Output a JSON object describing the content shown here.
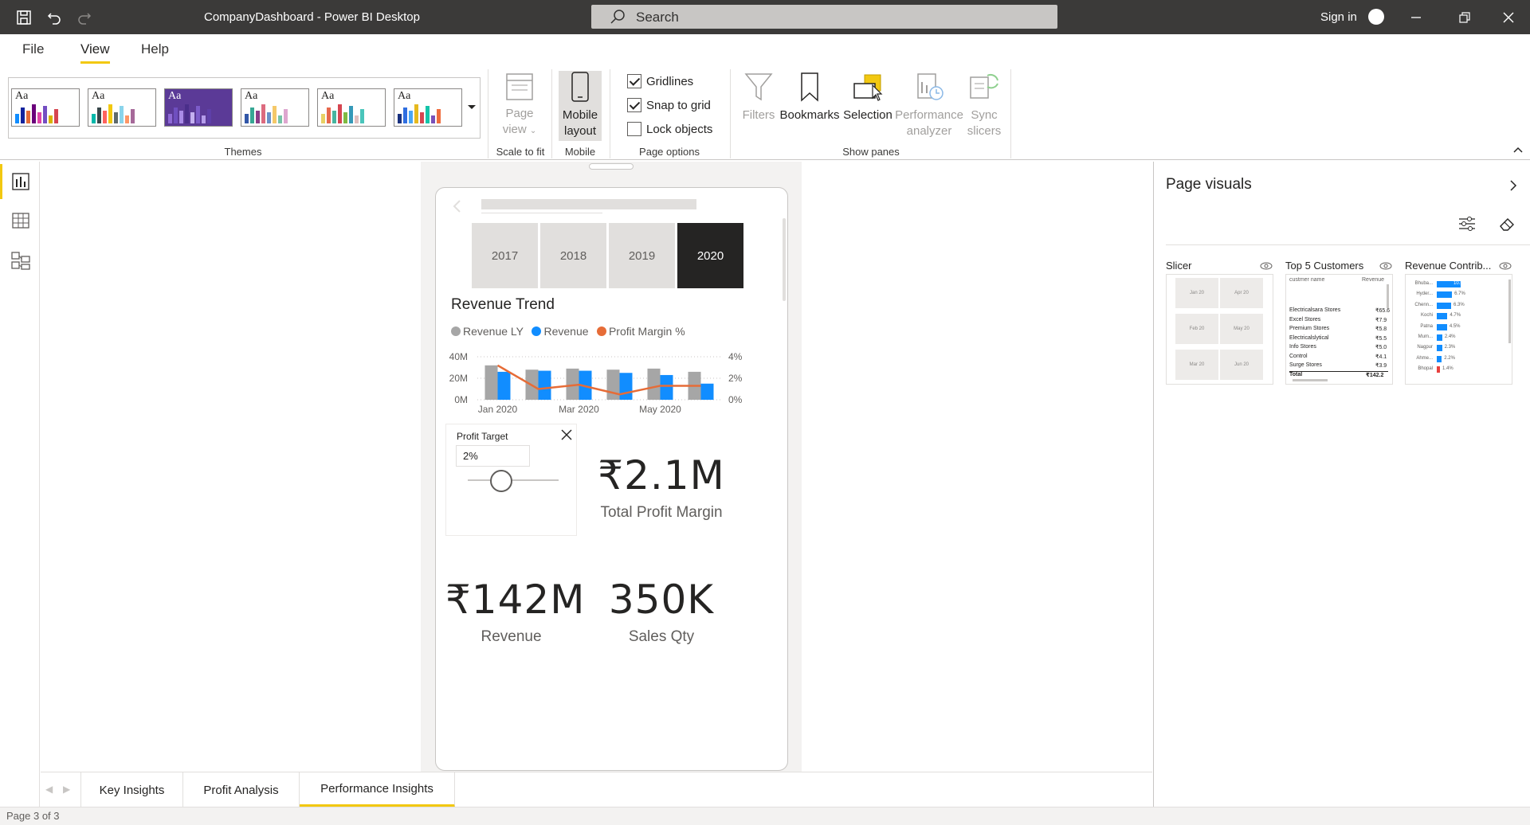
{
  "window": {
    "title": "CompanyDashboard - Power BI Desktop",
    "search_placeholder": "Search",
    "sign_in": "Sign in"
  },
  "menu": [
    {
      "label": "File"
    },
    {
      "label": "View",
      "active": true
    },
    {
      "label": "Help"
    }
  ],
  "ribbon": {
    "theme_label": "Aa",
    "groups": {
      "themes": "Themes",
      "scale_to_fit": "Scale to fit",
      "mobile": "Mobile",
      "page_options": "Page options",
      "show_panes": "Show panes"
    },
    "page_view": {
      "line1": "Page",
      "line2": "view"
    },
    "mobile_layout": {
      "line1": "Mobile",
      "line2": "layout"
    },
    "checkboxes": [
      {
        "label": "Gridlines",
        "checked": true
      },
      {
        "label": "Snap to grid",
        "checked": true
      },
      {
        "label": "Lock objects",
        "checked": false
      }
    ],
    "panes": {
      "filters": "Filters",
      "bookmarks": "Bookmarks",
      "selection": "Selection",
      "performance_line1": "Performance",
      "performance_line2": "analyzer",
      "sync_line1": "Sync",
      "sync_line2": "slicers"
    }
  },
  "mobile": {
    "years": [
      "2017",
      "2018",
      "2019",
      "2020"
    ],
    "selected_year": "2020",
    "chart_title": "Revenue Trend",
    "legend": [
      {
        "name": "Revenue LY",
        "color": "#a6a6a6"
      },
      {
        "name": "Revenue",
        "color": "#118dff"
      },
      {
        "name": "Profit Margin %",
        "color": "#e66c37"
      }
    ],
    "profit_target": {
      "title": "Profit Target",
      "value": "2%",
      "slider_fraction": 0.37
    },
    "total_profit_margin": {
      "value": "₹2.1M",
      "label": "Total Profit Margin"
    },
    "revenue": {
      "value": "₹142M",
      "label": "Revenue"
    },
    "sales_qty": {
      "value": "350K",
      "label": "Sales Qty"
    }
  },
  "chart_data": {
    "type": "bar",
    "title": "Revenue Trend",
    "categories": [
      "Jan 2020",
      "Feb 2020",
      "Mar 2020",
      "Apr 2020",
      "May 2020",
      "Jun 2020"
    ],
    "x_tick_labels": [
      "Jan 2020",
      "Mar 2020",
      "May 2020"
    ],
    "series": [
      {
        "name": "Revenue LY",
        "axis": "left",
        "values": [
          32,
          28,
          29,
          28,
          29,
          26
        ]
      },
      {
        "name": "Revenue",
        "axis": "left",
        "values": [
          26,
          27,
          27,
          25,
          23,
          15
        ]
      },
      {
        "name": "Profit Margin %",
        "axis": "right",
        "kind": "line",
        "values": [
          3.2,
          1.0,
          1.4,
          0.5,
          1.3,
          1.3
        ]
      }
    ],
    "y_ticks": [
      "0M",
      "20M",
      "40M"
    ],
    "y2_ticks": [
      "0%",
      "2%",
      "4%"
    ],
    "ylim": [
      0,
      40
    ],
    "y2lim": [
      0,
      4
    ],
    "grid": true
  },
  "page_visuals": {
    "title": "Page visuals",
    "cards": [
      {
        "title": "Slicer",
        "tiles": [
          "Jan 20",
          "Apr 20",
          "Feb 20",
          "May 20",
          "Mar 20",
          "Jun 20"
        ]
      },
      {
        "title": "Top 5 Customers",
        "headers": [
          "custmer name",
          "Revenue"
        ],
        "rows": [
          [
            "Electricalsara Stores",
            "₹65.6"
          ],
          [
            "Excel Stores",
            "₹7.9"
          ],
          [
            "Premium Stores",
            "₹5.8"
          ],
          [
            "Electricalslytical",
            "₹5.5"
          ],
          [
            "Info Stores",
            "₹5.0"
          ],
          [
            "Control",
            "₹4.1"
          ],
          [
            "Surge Stores",
            "₹3.9"
          ]
        ],
        "total": [
          "Total",
          "₹142.2"
        ]
      },
      {
        "title": "Revenue Contrib...",
        "rows": [
          {
            "city": "Bhuba...",
            "pct": 10.5,
            "label": "10.5%"
          },
          {
            "city": "Hyder...",
            "pct": 6.7,
            "label": "6.7%"
          },
          {
            "city": "Chenn...",
            "pct": 6.3,
            "label": "6.3%"
          },
          {
            "city": "Kochi",
            "pct": 4.7,
            "label": "4.7%"
          },
          {
            "city": "Patna",
            "pct": 4.5,
            "label": "4.5%"
          },
          {
            "city": "Mum...",
            "pct": 2.4,
            "label": "2.4%"
          },
          {
            "city": "Nagpur",
            "pct": 2.3,
            "label": "2.3%"
          },
          {
            "city": "Ahme...",
            "pct": 2.2,
            "label": "2.2%"
          },
          {
            "city": "Bhopal",
            "pct": 1.4,
            "label": "1.4%"
          }
        ]
      }
    ]
  },
  "tabs": [
    {
      "label": "Key Insights"
    },
    {
      "label": "Profit Analysis"
    },
    {
      "label": "Performance Insights",
      "active": true
    }
  ],
  "status": "Page 3 of 3"
}
